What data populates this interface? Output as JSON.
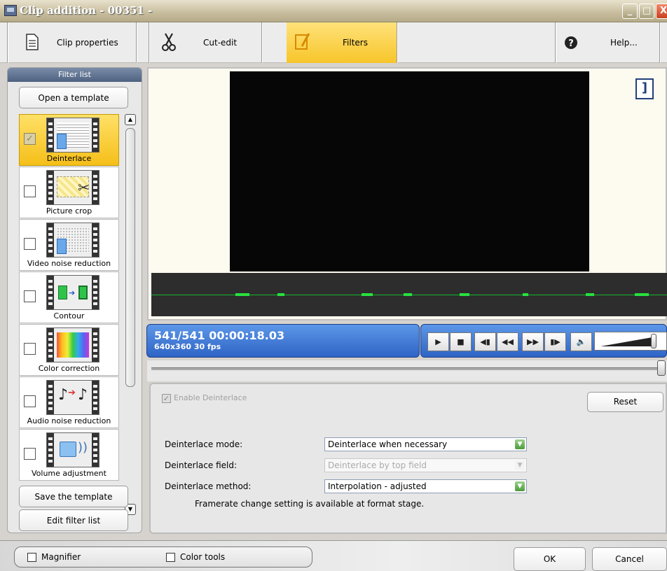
{
  "window": {
    "title": "Clip addition - 00351 -",
    "controls": {
      "minimize": "_",
      "maximize": "□",
      "close": "X"
    }
  },
  "toolbar": {
    "tabs": [
      {
        "label": "Clip properties",
        "icon": "document-icon",
        "active": false
      },
      {
        "label": "Cut-edit",
        "icon": "scissors-icon",
        "active": false
      },
      {
        "label": "Filters",
        "icon": "filter-pencil-icon",
        "active": true
      },
      {
        "label": "Help...",
        "icon": "help-icon",
        "active": false
      }
    ]
  },
  "filter_panel": {
    "header": "Filter list",
    "open_template": "Open a template",
    "items": [
      {
        "label": "Deinterlace",
        "checked": true,
        "selected": true,
        "icon": "deinterlace-icon"
      },
      {
        "label": "Picture crop",
        "checked": false,
        "selected": false,
        "icon": "crop-scissors-icon"
      },
      {
        "label": "Video noise reduction",
        "checked": false,
        "selected": false,
        "icon": "noise-icon"
      },
      {
        "label": "Contour",
        "checked": false,
        "selected": false,
        "icon": "contour-icon"
      },
      {
        "label": "Color correction",
        "checked": false,
        "selected": false,
        "icon": "color-spectrum-icon"
      },
      {
        "label": "Audio noise reduction",
        "checked": false,
        "selected": false,
        "icon": "audio-notes-icon"
      },
      {
        "label": "Volume adjustment",
        "checked": false,
        "selected": false,
        "icon": "speaker-icon"
      }
    ],
    "save_template": "Save the template",
    "edit_filter_list": "Edit filter list"
  },
  "player": {
    "position": "541/541  00:00:18.03",
    "info": "640x360 30 fps",
    "buttons": [
      "play-icon",
      "stop-icon",
      "step-back-icon",
      "rewind-icon",
      "fast-forward-icon",
      "step-forward-icon",
      "speaker-mute-icon"
    ],
    "glyphs": [
      "▶",
      "■",
      "◀▮",
      "◀◀",
      "▶▶",
      "▮▶",
      "🔈"
    ],
    "seek_position": 1.0,
    "volume_level": 1.0
  },
  "settings": {
    "enable_label": "Enable Deinterlace",
    "enable_checked": true,
    "reset": "Reset",
    "rows": [
      {
        "label": "Deinterlace mode:",
        "value": "Deinterlace when necessary",
        "enabled": true
      },
      {
        "label": "Deinterlace field:",
        "value": "Deinterlace by top field",
        "enabled": false
      },
      {
        "label": "Deinterlace method:",
        "value": "Interpolation - adjusted",
        "enabled": true
      }
    ],
    "note": "Framerate change setting is available at format stage."
  },
  "bottom": {
    "magnifier": "Magnifier",
    "color_tools": "Color tools",
    "ok": "OK",
    "cancel": "Cancel"
  },
  "colors": {
    "accent_yellow": "#f7c52a",
    "status_blue": "#2f64c5",
    "wave_green": "#27e13f"
  }
}
